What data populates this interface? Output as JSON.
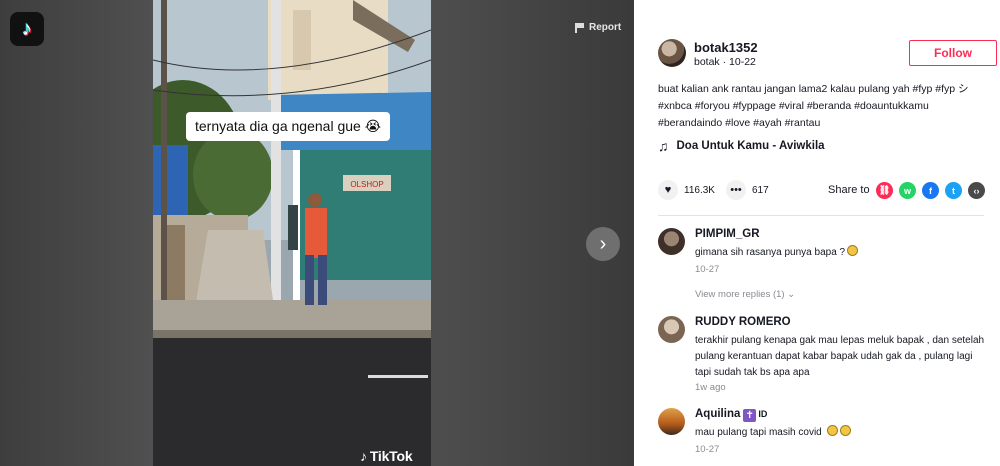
{
  "app": {
    "logo_icon": "tiktok-logo-icon"
  },
  "video": {
    "report_label": "Report",
    "caption": "ternyata dia ga ngenal gue 😭",
    "watermark": "TikTok",
    "next_icon": "chevron-right-icon",
    "shop_sign": "OLSHOP"
  },
  "author": {
    "username": "botak1352",
    "nickname": "botak",
    "date": "10-22",
    "follow_label": "Follow"
  },
  "description": {
    "text": "buat kalian ank rantau jangan lama2 kalau pulang yah #fyp #fyp シ #xnbca #foryou #fyppage #viral #beranda #doauntukkamu #berandaindo #love #ayah #rantau"
  },
  "music": {
    "icon": "music-note-icon",
    "title": "Doa Untuk Kamu - Aviwkila"
  },
  "actions": {
    "likes": "116.3K",
    "comments": "617",
    "share_label": "Share to",
    "share_targets": [
      {
        "name": "link",
        "color": "#fe2c55",
        "glyph": "🔗"
      },
      {
        "name": "whatsapp",
        "color": "#25d366",
        "glyph": "w"
      },
      {
        "name": "facebook",
        "color": "#1877f2",
        "glyph": "f"
      },
      {
        "name": "twitter",
        "color": "#1da1f2",
        "glyph": "t"
      },
      {
        "name": "embed",
        "color": "#4a4a4a",
        "glyph": "‹›"
      }
    ]
  },
  "comments": [
    {
      "name": "PIMPIM_GR",
      "text": "gimana sih rasanya punya bapa ?",
      "time": "10-27",
      "replies": "View more replies (1)",
      "avatar_color": "#5a4a40"
    },
    {
      "name": "RUDDY ROMERO",
      "text": "terakhir pulang kenapa gak mau lepas meluk bapak , dan setelah pulang kerantuan dapat kabar bapak udah gak da , pulang lagi tapi sudah tak bs apa apa",
      "time": "1w ago",
      "avatar_color": "#a08d7a"
    },
    {
      "name": "Aquilina",
      "name_badge": "✝",
      "name_suffix": "ID",
      "text": "mau pulang tapi masih covid",
      "time": "10-27",
      "avatar_color": "#c87a2a"
    }
  ]
}
